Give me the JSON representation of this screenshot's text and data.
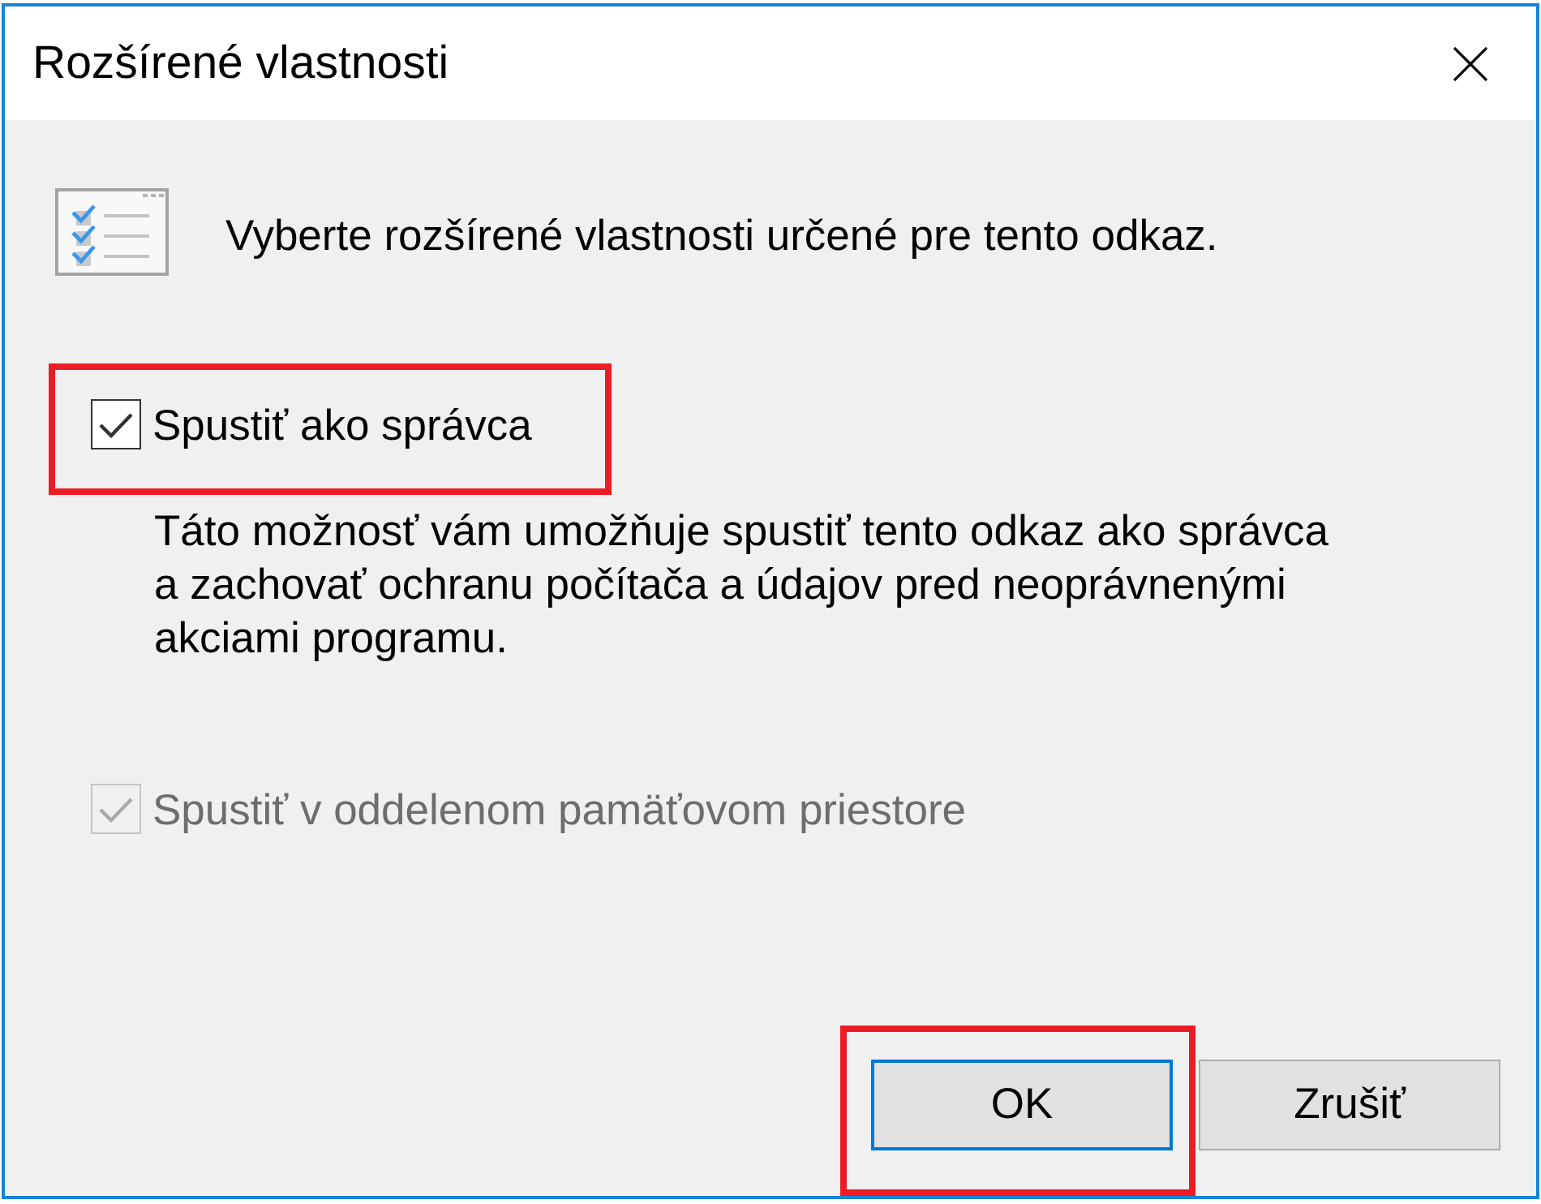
{
  "window": {
    "title": "Rozšírené vlastnosti"
  },
  "header": {
    "text": "Vyberte rozšírené vlastnosti určené pre tento odkaz."
  },
  "options": [
    {
      "label": "Spustiť ako správca",
      "checked": true,
      "disabled": false,
      "highlighted": true,
      "description": [
        "Táto možnosť vám umožňuje spustiť tento odkaz ako správca",
        "a zachovať ochranu počítača a údajov pred neoprávnenými",
        "akciami programu."
      ]
    },
    {
      "label": "Spustiť v oddelenom pamäťovom priestore",
      "checked": true,
      "disabled": true,
      "highlighted": false
    }
  ],
  "buttons": [
    {
      "label": "OK",
      "default": true,
      "highlighted": true
    },
    {
      "label": "Zrušiť",
      "default": false,
      "highlighted": false
    }
  ]
}
